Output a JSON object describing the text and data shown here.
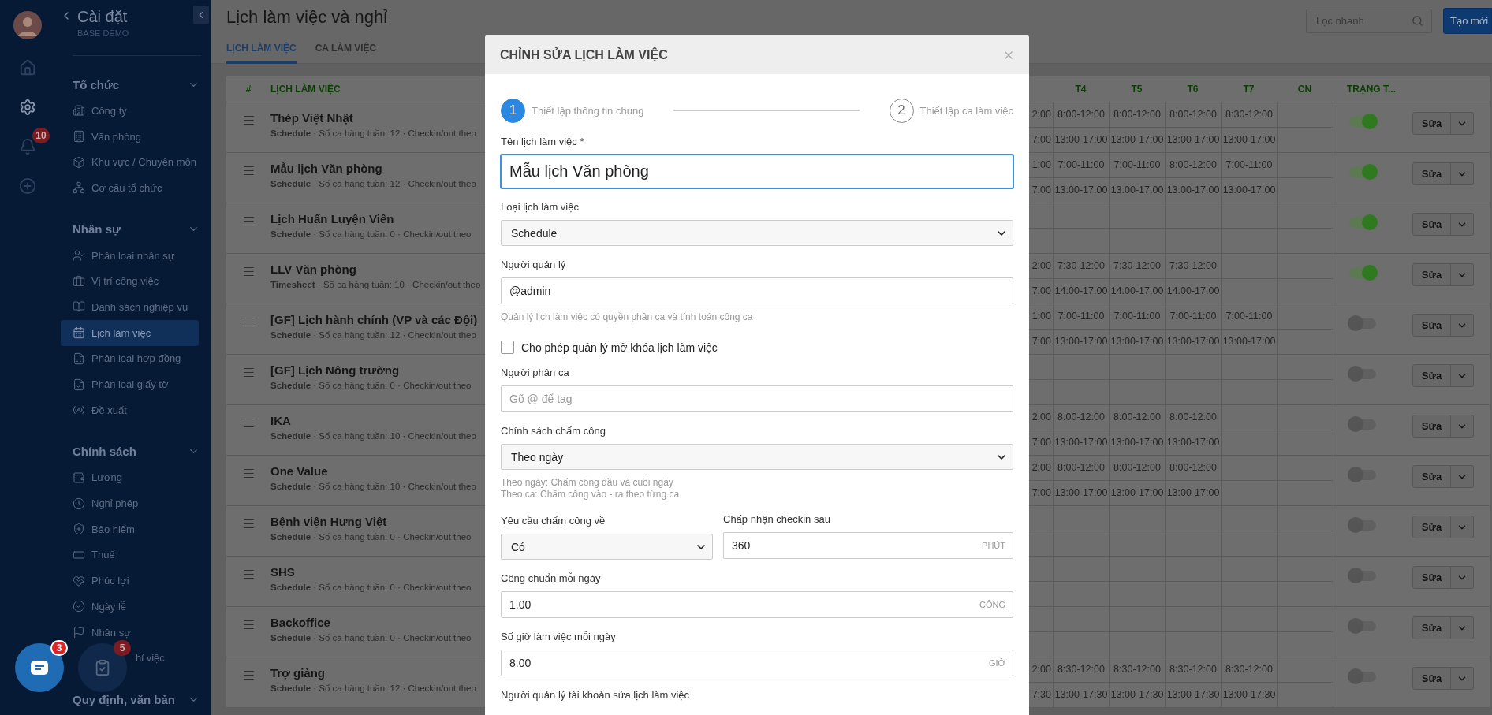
{
  "sidebar": {
    "rail": {
      "notification_badge": "10"
    },
    "title": "Cài đặt",
    "subtitle": "BASE DEMO",
    "sections": [
      {
        "title": "Tổ chức",
        "expanded": true,
        "items": [
          {
            "label": "Công ty",
            "selected": false
          },
          {
            "label": "Văn phòng",
            "selected": false
          },
          {
            "label": "Khu vực / Chuyên môn",
            "selected": false
          },
          {
            "label": "Cơ cấu tổ chức",
            "selected": false
          }
        ]
      },
      {
        "title": "Nhân sự",
        "expanded": true,
        "items": [
          {
            "label": "Phân loại nhân sự",
            "selected": false
          },
          {
            "label": "Vị trí công việc",
            "selected": false
          },
          {
            "label": "Danh sách nghiệp vụ",
            "selected": false
          },
          {
            "label": "Lịch làm việc",
            "selected": true
          },
          {
            "label": "Phân loại hợp đồng",
            "selected": false
          },
          {
            "label": "Phân loại giấy tờ",
            "selected": false
          },
          {
            "label": "Đề xuất",
            "selected": false
          }
        ]
      },
      {
        "title": "Chính sách",
        "expanded": true,
        "items": [
          {
            "label": "Lương",
            "selected": false
          },
          {
            "label": "Nghỉ phép",
            "selected": false
          },
          {
            "label": "Bảo hiểm",
            "selected": false
          },
          {
            "label": "Thuế",
            "selected": false
          },
          {
            "label": "Phúc lợi",
            "selected": false
          },
          {
            "label": "Ngày lễ",
            "selected": false
          },
          {
            "label": "Nhân sự",
            "selected": false
          },
          {
            "label": "hỉ việc",
            "selected": false,
            "covered": true
          }
        ]
      },
      {
        "title": "Quy định, văn bản",
        "expanded": true
      }
    ]
  },
  "floating_buttons": [
    {
      "kind": "chat",
      "badge": "3"
    },
    {
      "kind": "tasks",
      "badge": "5"
    }
  ],
  "page": {
    "title": "Lịch làm việc và nghỉ",
    "search": {
      "placeholder": "Lọc nhanh"
    },
    "create_button": "Tạo mới",
    "tabs": [
      {
        "label": "LỊCH LÀM VIỆC",
        "selected": true
      },
      {
        "label": "CA LÀM VIỆC",
        "selected": false
      }
    ]
  },
  "table": {
    "columns": [
      "#",
      "LỊCH LÀM VIỆC",
      "T4",
      "T5",
      "T6",
      "T7",
      "CN",
      "TRẠNG T..."
    ],
    "rows": [
      {
        "name": "Thép Việt Nhật",
        "summary": "**Schedule** · Số ca hàng tuần: 12 · Checkin/out theo",
        "active": true,
        "edit_label": "Sửa",
        "shifts": [
          {
            "partial": "2:00",
            "days": [
              "8:00-12:00",
              "8:00-12:00",
              "8:00-12:00",
              "8:30-12:00"
            ]
          },
          {
            "partial": "7:00",
            "days": [
              "13:00-17:00",
              "13:00-17:00",
              "13:00-17:00",
              "13:00-17:00"
            ]
          }
        ]
      },
      {
        "name": "Mẫu lịch Văn phòng",
        "summary": "**Schedule** · Số ca hàng tuần: 12 · Checkin/out theo",
        "active": true,
        "edit_label": "Sửa",
        "shifts": [
          {
            "partial": "1:00",
            "days": [
              "7:00-11:00",
              "7:00-11:00",
              "8:00-12:00",
              "7:00-11:00"
            ]
          },
          {
            "partial": "7:00",
            "days": [
              "13:00-17:00",
              "13:00-17:00",
              "13:00-17:00",
              "13:00-17:00"
            ]
          }
        ]
      },
      {
        "name": "Lịch Huấn Luyện Viên",
        "summary": "**Schedule** · Số ca hàng tuần: 0 · Checkin/out theo",
        "active": true,
        "edit_label": "Sửa"
      },
      {
        "name": "LLV Văn phòng",
        "summary": "**Timesheet** · Số ca hàng tuần: 10 · Checkin/out theo",
        "active": true,
        "edit_label": "Sửa",
        "shifts": [
          {
            "partial": "2:00",
            "days": [
              "7:30-12:00",
              "7:30-12:00",
              "7:30-12:00"
            ]
          },
          {
            "partial": "7:00",
            "days": [
              "14:00-17:00",
              "14:00-17:00",
              "14:00-17:00"
            ]
          }
        ]
      },
      {
        "name": "[GF] Lịch hành chính (VP và các Đội)",
        "summary": "**Schedule** · Số ca hàng tuần: 12 · Checkin/out theo",
        "active": false,
        "edit_label": "Sửa",
        "shifts": [
          {
            "partial": "1:00",
            "days": [
              "7:00-11:00",
              "7:00-11:00",
              "7:00-11:00",
              "7:00-11:00"
            ]
          },
          {
            "partial": "7:00",
            "days": [
              "13:00-17:00",
              "13:00-17:00",
              "13:00-17:00",
              "13:00-17:00"
            ]
          }
        ]
      },
      {
        "name": "[GF] Lịch Nông trường",
        "summary": "**Schedule** · Số ca hàng tuần: 0 · Checkin/out theo",
        "active": false,
        "edit_label": "Sửa"
      },
      {
        "name": "IKA",
        "summary": "**Schedule** · Số ca hàng tuần: 10 · Checkin/out theo",
        "active": false,
        "edit_label": "Sửa",
        "shifts": [
          {
            "partial": "2:00",
            "days": [
              "8:00-12:00",
              "8:00-12:00",
              "8:00-12:00"
            ]
          },
          {
            "partial": "7:00",
            "days": [
              "13:00-17:00",
              "13:00-17:00",
              "13:00-17:00"
            ]
          }
        ]
      },
      {
        "name": "One Value",
        "summary": "**Schedule** · Số ca hàng tuần: 10 · Checkin/out theo",
        "active": false,
        "edit_label": "Sửa",
        "shifts": [
          {
            "partial": "2:00",
            "days": [
              "8:00-12:00",
              "8:00-12:00",
              "8:00-12:00"
            ]
          },
          {
            "partial": "7:00",
            "days": [
              "13:00-17:00",
              "13:00-17:00",
              "13:00-17:00"
            ]
          }
        ]
      },
      {
        "name": "Bệnh viện Hưng Việt",
        "summary": "**Schedule** · Số ca hàng tuần: 0 · Checkin/out theo",
        "active": false,
        "edit_label": "Sửa"
      },
      {
        "name": "SHS",
        "summary": "**Schedule** · Số ca hàng tuần: 0 · Checkin/out theo",
        "active": false,
        "edit_label": "Sửa"
      },
      {
        "name": "Backoffice",
        "summary": "**Schedule** · Số ca hàng tuần: 0 · Checkin/out theo",
        "active": false,
        "edit_label": "Sửa"
      },
      {
        "name": "Trợ giảng",
        "summary": "**Schedule** · Số ca hàng tuần: 12 · Checkin/out theo",
        "active": false,
        "edit_label": "Sửa",
        "shifts": [
          {
            "partial": "2:00",
            "days": [
              "8:30-12:00",
              "8:30-12:00",
              "8:30-12:00",
              "8:30-12:00"
            ]
          },
          {
            "partial": "7:30",
            "days": [
              "13:00-17:30",
              "13:00-17:30",
              "13:00-17:30",
              "13:00-17:30"
            ]
          }
        ]
      }
    ]
  },
  "modal": {
    "title": "CHỈNH SỬA LỊCH LÀM VIỆC",
    "steps": [
      {
        "number": "1",
        "label": "Thiết lập thông tin chung",
        "selected": true
      },
      {
        "number": "2",
        "label": "Thiết lập ca làm việc",
        "selected": false
      }
    ],
    "fields": [
      {
        "kind": "input",
        "label": "Tên lịch làm việc *",
        "value": "Mẫu lịch Văn phòng",
        "focused": true
      },
      {
        "kind": "select",
        "label": "Loại lịch làm việc",
        "value": "Schedule"
      },
      {
        "kind": "input",
        "label": "Người quản lý",
        "value": "@admin",
        "focused": false,
        "help": [
          "Quản lý lịch làm việc có quyền phân ca và tính toán công ca"
        ]
      },
      {
        "kind": "checkbox",
        "label": "Cho phép quản lý mở khóa lịch làm việc",
        "checked": false
      },
      {
        "kind": "input",
        "label": "Người phân ca",
        "placeholder": "Gõ @ để tag",
        "focused": false
      },
      {
        "kind": "select",
        "label": "Chính sách chấm công",
        "value": "Theo ngày",
        "help": [
          "Theo ngày: Chấm công đầu và cuối ngày",
          "Theo ca: Chấm công vào - ra theo từng ca"
        ]
      },
      {
        "kind": "pair",
        "items": [
          {
            "kind": "select",
            "label": "Yêu cầu chấm công về",
            "value": "Có"
          },
          {
            "kind": "input",
            "label": "Chấp nhận checkin sau",
            "value": "360",
            "unit": "PHÚT"
          }
        ]
      },
      {
        "kind": "input",
        "label": "Công chuẩn mỗi ngày",
        "value": "1.00",
        "unit": "CÔNG"
      },
      {
        "kind": "input",
        "label": "Số giờ làm việc mỗi ngày",
        "value": "8.00",
        "unit": "GIỜ"
      },
      {
        "kind": "heading",
        "label": "Người quản lý tài khoản sửa lịch làm việc"
      }
    ]
  }
}
